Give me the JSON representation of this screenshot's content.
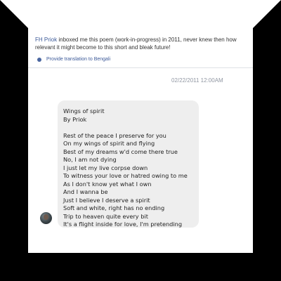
{
  "post": {
    "author": "FH Priok",
    "intro_text": " inboxed me this poem (work-in-progress) in 2011, never knew then how relevant it might become to this short and bleak future!",
    "translate_icon": "globe-icon",
    "translate_label": "Provide translation to Bengali"
  },
  "message": {
    "timestamp": "02/22/2011 12:00AM",
    "avatar_icon": "profile-photo",
    "lines": [
      "Wings of spirit",
      "By Priok",
      "",
      "Rest of the peace I preserve for you",
      "On my wings of spirit and flying",
      "Best of my dreams w'd come there true",
      "No, I am not dying",
      "I just let my live corpse down",
      "To witness your love or hatred owing to me",
      "As I don't know yet what I own",
      "And I wanna be",
      "Just I believe I deserve a spirit",
      "Soft and white, right has no ending",
      "Trip to heaven quite every bit",
      "It's a flight inside for love, I'm pretending"
    ]
  },
  "colors": {
    "link": "#3b5998",
    "bubble": "#eeeeee",
    "frame": "#000000"
  }
}
